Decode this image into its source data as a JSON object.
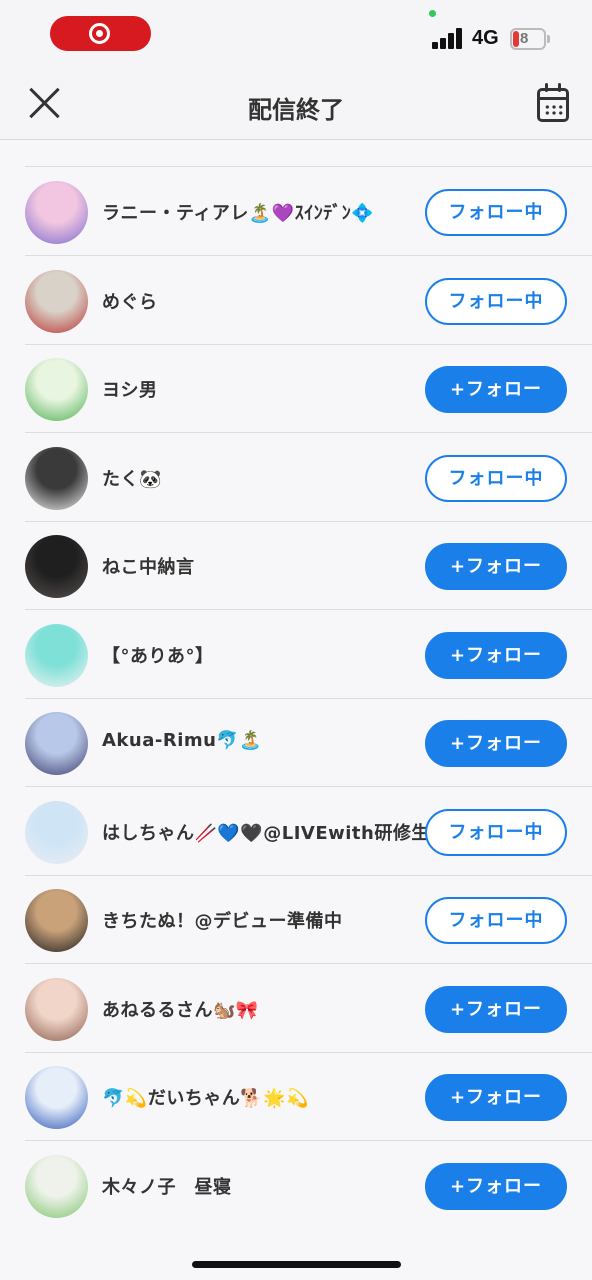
{
  "status_bar": {
    "network": "4G",
    "battery": "8",
    "colors": {
      "record": "#d71920",
      "battery_low": "#e53935"
    }
  },
  "nav": {
    "title": "配信終了"
  },
  "accent_color": "#1a7fe8",
  "users": [
    {
      "name": "ラニー・ティアレ🏝️💜ｽｲﾝﾃﾞﾝ💠",
      "button": "フォロー中",
      "state": "following",
      "avatar": [
        "#f2c6e0",
        "#7a6bd0"
      ]
    },
    {
      "name": "めぐら",
      "button": "フォロー中",
      "state": "following",
      "avatar": [
        "#d9d2c8",
        "#b8312f"
      ]
    },
    {
      "name": "ヨシ男",
      "button": "+フォロー",
      "state": "follow",
      "avatar": [
        "#e8f5e0",
        "#4caf50"
      ]
    },
    {
      "name": "たく🐼",
      "button": "フォロー中",
      "state": "following",
      "avatar": [
        "#3a3a3a",
        "#f0f0f0"
      ]
    },
    {
      "name": "ねこ中納言",
      "button": "+フォロー",
      "state": "follow",
      "avatar": [
        "#1f1f1f",
        "#5a5050"
      ]
    },
    {
      "name": "【°ありあ°】",
      "button": "+フォロー",
      "state": "follow",
      "avatar": [
        "#7fe0d8",
        "#f3f3f3"
      ]
    },
    {
      "name": "Akua-Rimu🐬🏝️",
      "button": "+フォロー",
      "state": "follow",
      "avatar": [
        "#b8c8e8",
        "#3b3b6b"
      ]
    },
    {
      "name": "はしちゃん🥢💙🖤@LIVEwith研修生",
      "button": "フォロー中",
      "state": "following",
      "avatar": [
        "#cfe4f5",
        "#e9eef5"
      ]
    },
    {
      "name": "きちたぬ！@デビュー準備中",
      "button": "フォロー中",
      "state": "following",
      "avatar": [
        "#c9a27a",
        "#1a1a1a"
      ]
    },
    {
      "name": "あねるるさん🐿️🎀",
      "button": "+フォロー",
      "state": "follow",
      "avatar": [
        "#f0d5c8",
        "#8a5a4a"
      ]
    },
    {
      "name": "🐬💫だいちゃん🐕🌟💫",
      "button": "+フォロー",
      "state": "follow",
      "avatar": [
        "#e6eef9",
        "#2a55b8"
      ]
    },
    {
      "name": "木々ノ子　昼寝",
      "button": "+フォロー",
      "state": "follow",
      "avatar": [
        "#eef2ea",
        "#7bc46a"
      ]
    }
  ]
}
